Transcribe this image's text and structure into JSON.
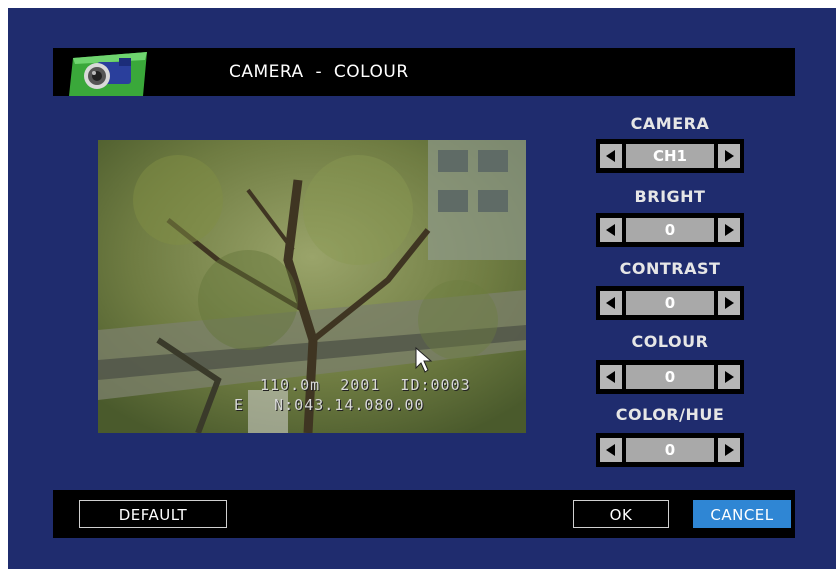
{
  "header": {
    "title": "CAMERA  -  COLOUR",
    "icon": "camera-icon"
  },
  "preview": {
    "osd_line1": "110.0m  2001  ID:0003",
    "osd_line2": "E   N:043.14.080.00"
  },
  "controls": {
    "camera": {
      "label": "CAMERA",
      "value": "CH1"
    },
    "bright": {
      "label": "BRIGHT",
      "value": "0"
    },
    "contrast": {
      "label": "CONTRAST",
      "value": "0"
    },
    "colour": {
      "label": "COLOUR",
      "value": "0"
    },
    "color_hue": {
      "label": "COLOR/HUE",
      "value": "0"
    }
  },
  "footer": {
    "default_label": "DEFAULT",
    "ok_label": "OK",
    "cancel_label": "CANCEL"
  },
  "colors": {
    "background": "#1f2c6e",
    "bar": "#000000",
    "cancel_accent": "#2f86d4"
  }
}
